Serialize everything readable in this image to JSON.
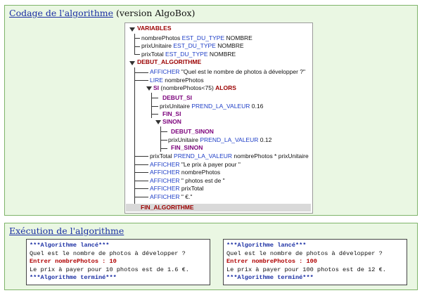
{
  "code_panel": {
    "title_link": "Codage de l'algorithme",
    "title_suffix": " (version AlgoBox)"
  },
  "tree": {
    "variables": "VARIABLES",
    "var1_name": "nombrePhotos",
    "var2_name": "prixUnitaire",
    "var3_name": "prixTotal",
    "est_du_type": "EST_DU_TYPE",
    "type": "NOMBRE",
    "debut_algo": "DEBUT_ALGORITHME",
    "afficher": "AFFICHER",
    "prompt_str": "\"Quel est le nombre de photos à développer ?\"",
    "lire": "LIRE",
    "lire_var": "nombrePhotos",
    "si": "SI",
    "si_cond": "(nombrePhotos<75)",
    "alors": "ALORS",
    "debut_si": "DEBUT_SI",
    "prend_la_valeur": "PREND_LA_VALEUR",
    "val_si": "0.16",
    "fin_si": "FIN_SI",
    "sinon": "SINON",
    "debut_sinon": "DEBUT_SINON",
    "val_sinon": "0.12",
    "fin_sinon": "FIN_SINON",
    "total_expr": "nombrePhotos * prixUnitaire",
    "aff1": "\"Le prix à payer pour \"",
    "aff2": "nombrePhotos",
    "aff3": "\" photos est de \"",
    "aff4": "prixTotal",
    "aff5": "\" €.\"",
    "fin_algo": "FIN_ALGORITHME"
  },
  "exec_panel": {
    "title_link": "Exécution de l'algorithme"
  },
  "console_left": {
    "start": "***Algorithme lancé***",
    "question": "Quel est le nombre de photos à développer ?",
    "input": "Entrer nombrePhotos : 10",
    "result": "Le prix à payer pour 10 photos est de 1.6 €.",
    "end": "***Algorithme terminé***"
  },
  "console_right": {
    "start": "***Algorithme lancé***",
    "question": "Quel est le nombre de photos à développer ?",
    "input": "Entrer nombrePhotos : 100",
    "result": "Le prix à payer pour 100 photos est de 12 €.",
    "end": "***Algorithme terminé***"
  }
}
